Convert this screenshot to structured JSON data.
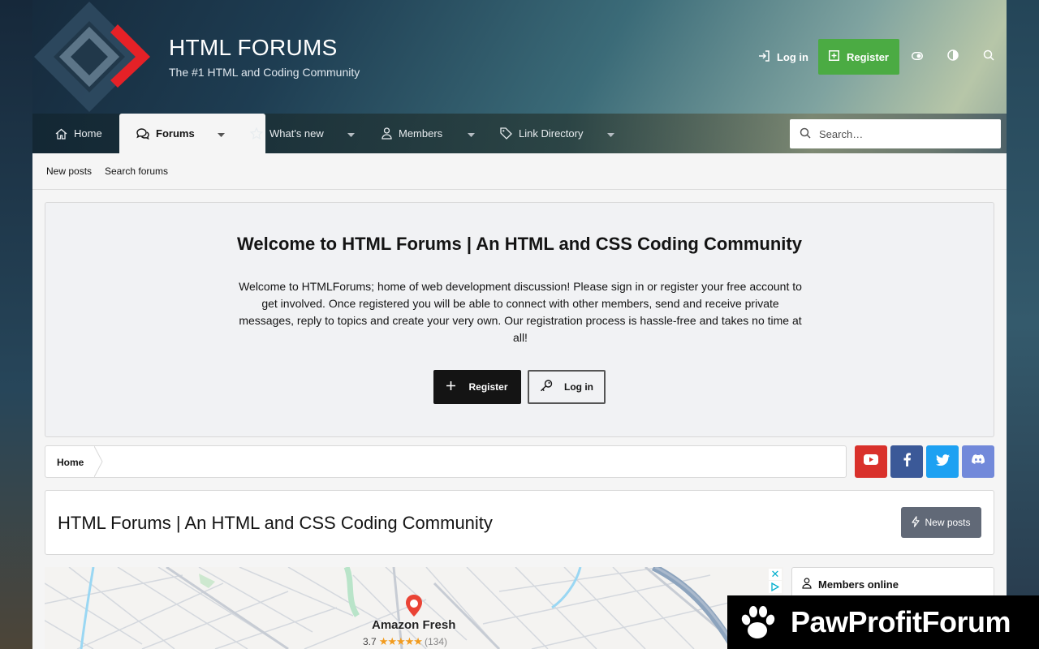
{
  "header": {
    "site_title": "HTML FORUMS",
    "tagline": "The #1 HTML and Coding Community",
    "login_label": "Log in",
    "register_label": "Register",
    "accent_green": "#4bab43"
  },
  "nav": {
    "tabs": [
      {
        "label": "Home",
        "icon": "home-icon"
      },
      {
        "label": "Forums",
        "icon": "comments-icon",
        "active": true
      },
      {
        "label": "What's new",
        "icon": "star-icon"
      },
      {
        "label": "Members",
        "icon": "user-icon"
      },
      {
        "label": "Link Directory",
        "icon": "tag-icon"
      }
    ],
    "search_placeholder": "Search…"
  },
  "subnav": {
    "items": [
      "New posts",
      "Search forums"
    ]
  },
  "notice": {
    "heading": "Welcome to HTML Forums | An HTML and CSS Coding Community",
    "body": "Welcome to HTMLForums; home of web development discussion! Please sign in or register your free account to get involved. Once registered you will be able to connect with other members, send and receive private messages, reply to topics and create your very own. Our registration process is hassle-free and takes no time at all!",
    "register_label": "Register",
    "login_label": "Log in"
  },
  "breadcrumb": {
    "home_label": "Home"
  },
  "social": [
    {
      "name": "youtube-icon",
      "color": "#d9312b"
    },
    {
      "name": "facebook-icon",
      "color": "#3b5998"
    },
    {
      "name": "twitter-icon",
      "color": "#1da1f2"
    },
    {
      "name": "discord-icon",
      "color": "#7289da"
    }
  ],
  "page_title": {
    "title": "HTML Forums | An HTML and CSS Coding Community",
    "new_posts_label": "New posts"
  },
  "ad": {
    "place_name": "Amazon Fresh",
    "rating": "3.7",
    "stars": "★★★★★",
    "review_count": "(134)"
  },
  "sidebar": {
    "members_online_title": "Members online"
  },
  "banner": {
    "text": "PawProfitForum"
  }
}
